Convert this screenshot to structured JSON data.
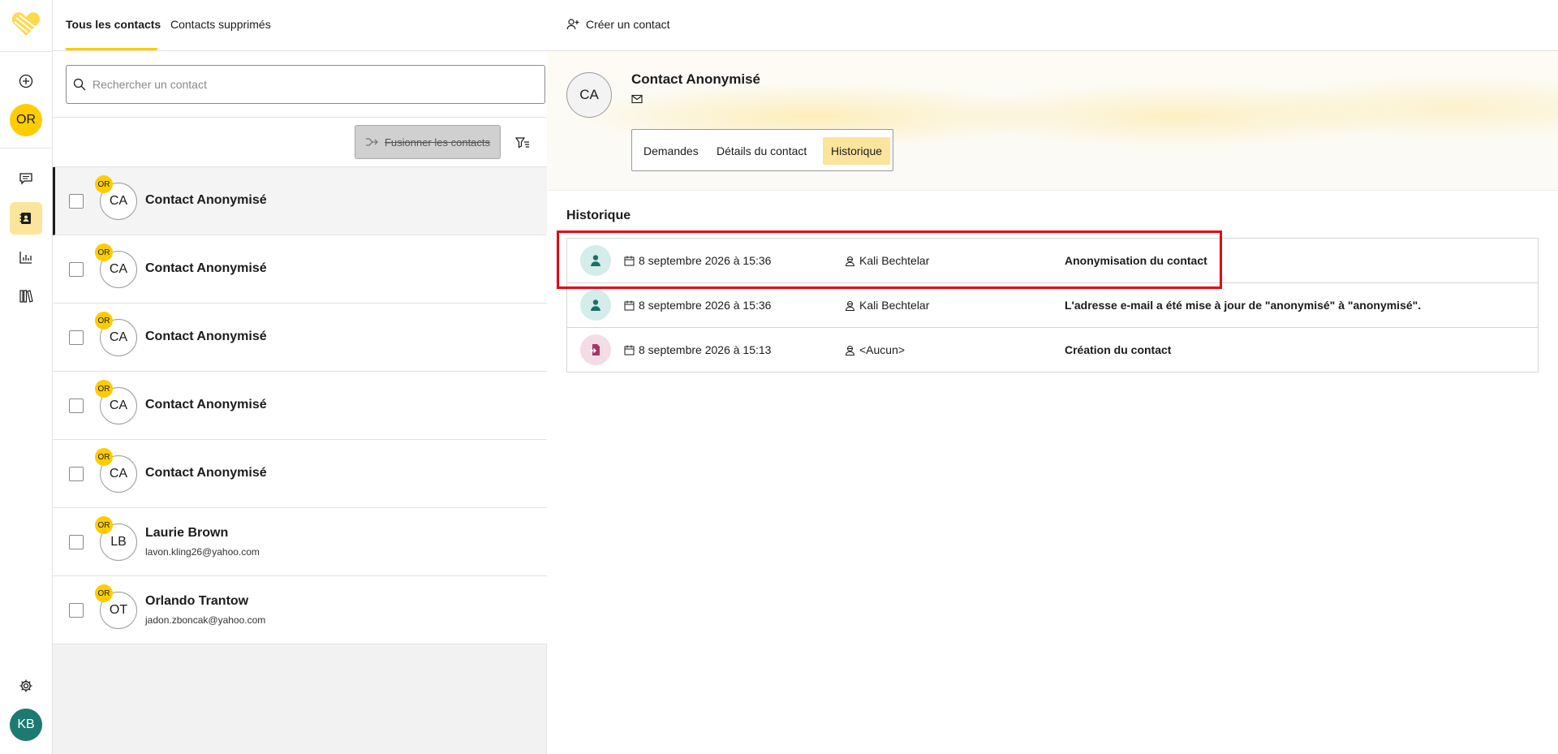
{
  "rail": {
    "org_initials": "OR",
    "user_initials": "KB",
    "icons": [
      "add-circle-icon",
      "chat-icon",
      "contacts-icon",
      "chart-icon",
      "library-icon",
      "gear-icon"
    ]
  },
  "list": {
    "tabs": [
      {
        "label": "Tous les contacts",
        "active": true
      },
      {
        "label": "Contacts supprimés",
        "active": false
      }
    ],
    "search": {
      "placeholder": "Rechercher un contact",
      "value": ""
    },
    "merge_label": "Fusionner les contacts",
    "contacts": [
      {
        "initials": "CA",
        "badge": "OR",
        "name": "Contact Anonymisé",
        "email": "",
        "selected": true
      },
      {
        "initials": "CA",
        "badge": "OR",
        "name": "Contact Anonymisé",
        "email": ""
      },
      {
        "initials": "CA",
        "badge": "OR",
        "name": "Contact Anonymisé",
        "email": ""
      },
      {
        "initials": "CA",
        "badge": "OR",
        "name": "Contact Anonymisé",
        "email": ""
      },
      {
        "initials": "CA",
        "badge": "OR",
        "name": "Contact Anonymisé",
        "email": ""
      },
      {
        "initials": "LB",
        "badge": "OR",
        "name": "Laurie Brown",
        "email": "lavon.kling26@yahoo.com"
      },
      {
        "initials": "OT",
        "badge": "OR",
        "name": "Orlando Trantow",
        "email": "jadon.zboncak@yahoo.com"
      }
    ]
  },
  "detail": {
    "create_label": "Créer un contact",
    "contact": {
      "initials": "CA",
      "name": "Contact Anonymisé"
    },
    "tabs": [
      {
        "label": "Demandes",
        "active": false
      },
      {
        "label": "Détails du contact",
        "active": false
      },
      {
        "label": "Historique",
        "active": true
      }
    ],
    "history_title": "Historique",
    "history": [
      {
        "icon": "user-icon",
        "date": "8 septembre 2026 à 15:36",
        "author": "Kali Bechtelar",
        "action": "Anonymisation du contact"
      },
      {
        "icon": "user-icon",
        "date": "8 septembre 2026 à 15:36",
        "author": "Kali Bechtelar",
        "action": "L'adresse e-mail a été mise à jour de \"anonymisé\" à \"anonymisé\"."
      },
      {
        "icon": "import-icon",
        "date": "8 septembre 2026 à 15:13",
        "author": "<Aucun>",
        "action": "Création du contact"
      }
    ]
  },
  "colors": {
    "accent": "#ffcc00",
    "accent_soft": "#fbe59c",
    "user_avatar": "#1c7a70",
    "highlight": "#e30613"
  }
}
